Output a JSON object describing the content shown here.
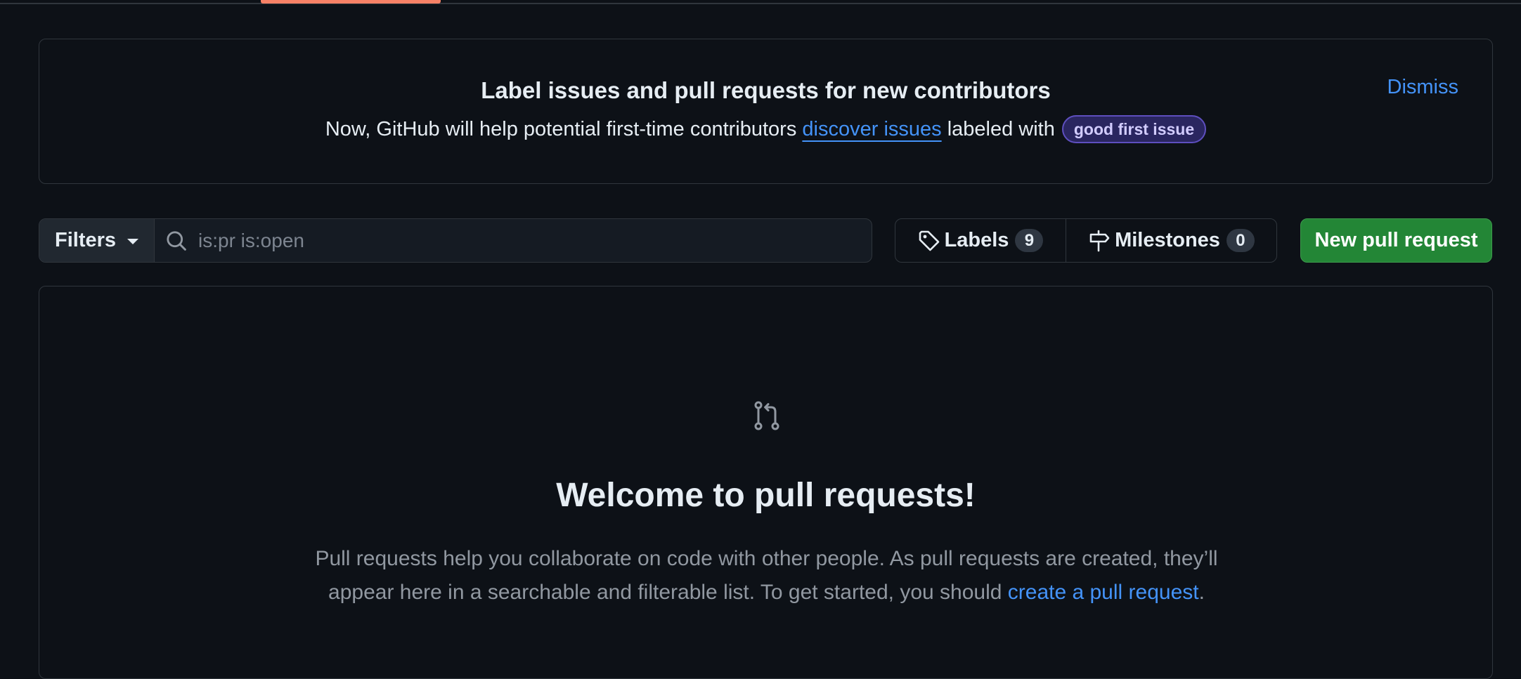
{
  "banner": {
    "title": "Label issues and pull requests for new contributors",
    "text_before": "Now, GitHub will help potential first-time contributors ",
    "link_text": "discover issues",
    "text_after": " labeled with",
    "label_pill": "good first issue",
    "dismiss_label": "Dismiss"
  },
  "toolbar": {
    "filters_label": "Filters",
    "search_value": "",
    "search_placeholder": "is:pr is:open",
    "labels_label": "Labels",
    "labels_count": "9",
    "milestones_label": "Milestones",
    "milestones_count": "0",
    "new_pr_label": "New pull request"
  },
  "blankslate": {
    "icon": "git-pull-request-icon",
    "heading": "Welcome to pull requests!",
    "description_before": "Pull requests help you collaborate on code with other people. As pull requests are created, they’ll appear here in a searchable and filterable list. To get started, you should ",
    "link_text": "create a pull request",
    "description_after": "."
  },
  "colors": {
    "background": "#0d1117",
    "border": "#30363d",
    "accent_link": "#4493f8",
    "primary_button": "#238636",
    "active_tab_underline": "#f78166"
  }
}
